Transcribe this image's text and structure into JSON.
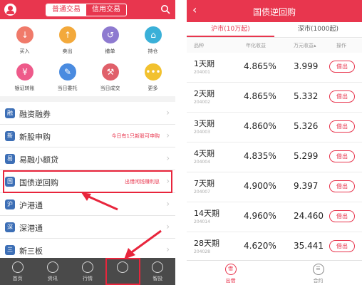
{
  "left": {
    "top_tabs": [
      "普通交易",
      "信用交易"
    ],
    "grid": [
      {
        "label": "买入",
        "icon": "buy-icon",
        "color": "#f07a6a",
        "glyph": "↓"
      },
      {
        "label": "卖出",
        "icon": "sell-icon",
        "color": "#f3a93b",
        "glyph": "↑"
      },
      {
        "label": "撤单",
        "icon": "cancel-order-icon",
        "color": "#8e7ad0",
        "glyph": "↺"
      },
      {
        "label": "持仓",
        "icon": "position-icon",
        "color": "#3ab0d8",
        "glyph": "⌂"
      },
      {
        "label": "银证转账",
        "icon": "transfer-icon",
        "color": "#ee5a8a",
        "glyph": "¥"
      },
      {
        "label": "当日委托",
        "icon": "daily-order-icon",
        "color": "#4a8be0",
        "glyph": "✎"
      },
      {
        "label": "当日成交",
        "icon": "daily-deal-icon",
        "color": "#e0606a",
        "glyph": "⚒"
      },
      {
        "label": "更多",
        "icon": "more-icon",
        "color": "#f2c12e",
        "glyph": "•••"
      }
    ],
    "list": [
      {
        "label": "融资融券",
        "hint": "",
        "icon": "margin-icon",
        "glyph": "融"
      },
      {
        "label": "新股申购",
        "hint": "今日有1只新股可申购",
        "icon": "ipo-icon",
        "glyph": "新"
      },
      {
        "label": "易融小额贷",
        "hint": "",
        "icon": "loan-icon",
        "glyph": "易"
      },
      {
        "label": "国债逆回购",
        "hint": "出借闲钱赚利息",
        "icon": "repo-icon",
        "glyph": "国"
      },
      {
        "label": "沪港通",
        "hint": "",
        "icon": "hk-sh-connect-icon",
        "glyph": "沪"
      },
      {
        "label": "深港通",
        "hint": "",
        "icon": "hk-sz-connect-icon",
        "glyph": "深"
      },
      {
        "label": "新三板",
        "hint": "",
        "icon": "neeq-icon",
        "glyph": "三"
      }
    ],
    "bottom_nav": [
      {
        "label": "首页",
        "icon": "home-icon"
      },
      {
        "label": "资讯",
        "icon": "news-icon"
      },
      {
        "label": "行情",
        "icon": "market-icon"
      },
      {
        "label": "",
        "icon": "trade-icon"
      },
      {
        "label": "智投",
        "icon": "smart-invest-icon"
      }
    ],
    "accent": "#e8364e"
  },
  "right": {
    "title": "国债逆回购",
    "back": "‹",
    "tabs": [
      "沪市(10万起)",
      "深市(1000起)"
    ],
    "headers": {
      "name": "品种",
      "rate": "年化收益",
      "earn": "万元收益",
      "sort": "▴",
      "action": "操作"
    },
    "rows": [
      {
        "name": "1天期",
        "code": "204001",
        "rate": "4.865%",
        "earn": "3.999",
        "btn": "借出"
      },
      {
        "name": "2天期",
        "code": "204002",
        "rate": "4.865%",
        "earn": "5.332",
        "btn": "借出"
      },
      {
        "name": "3天期",
        "code": "204003",
        "rate": "4.860%",
        "earn": "5.326",
        "btn": "借出"
      },
      {
        "name": "4天期",
        "code": "204004",
        "rate": "4.835%",
        "earn": "5.299",
        "btn": "借出"
      },
      {
        "name": "7天期",
        "code": "204007",
        "rate": "4.900%",
        "earn": "9.397",
        "btn": "借出"
      },
      {
        "name": "14天期",
        "code": "204014",
        "rate": "4.960%",
        "earn": "24.460",
        "btn": "借出"
      },
      {
        "name": "28天期",
        "code": "204028",
        "rate": "4.620%",
        "earn": "35.441",
        "btn": "借出"
      }
    ],
    "bottom_nav": [
      {
        "label": "出借",
        "icon": "lend-icon",
        "glyph": "借"
      },
      {
        "label": "合约",
        "icon": "contract-icon",
        "glyph": "☰"
      }
    ]
  }
}
